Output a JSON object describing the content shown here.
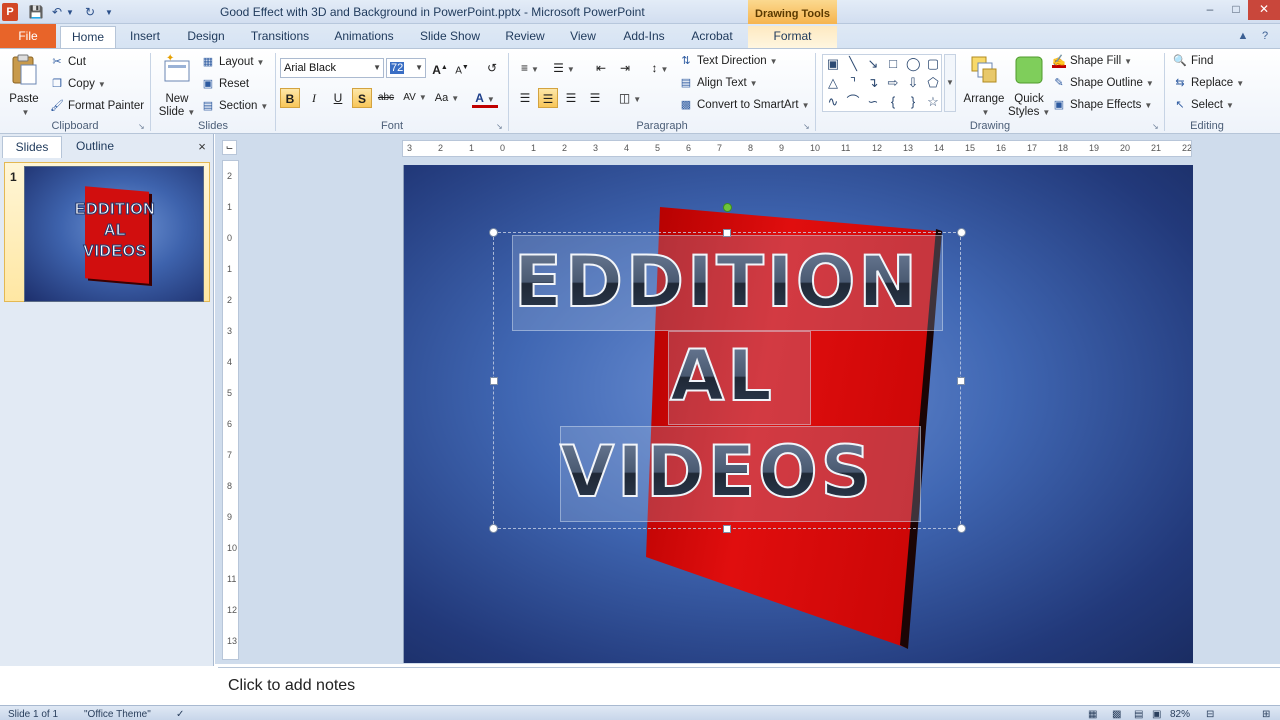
{
  "window": {
    "title": "Good Effect with 3D and Background in PowerPoint.pptx - Microsoft PowerPoint",
    "contextual_tab_group": "Drawing Tools",
    "app_icon": "P",
    "controls": {
      "minimize": "–",
      "maximize": "□",
      "close": "✕"
    }
  },
  "tabs": [
    "File",
    "Home",
    "Insert",
    "Design",
    "Transitions",
    "Animations",
    "Slide Show",
    "Review",
    "View",
    "Add-Ins",
    "Acrobat",
    "Format"
  ],
  "ribbon": {
    "clipboard": {
      "label": "Clipboard",
      "paste": "Paste",
      "cut": "Cut",
      "copy": "Copy",
      "format_painter": "Format Painter"
    },
    "slides": {
      "label": "Slides",
      "new_slide_1": "New",
      "new_slide_2": "Slide",
      "layout": "Layout",
      "reset": "Reset",
      "section": "Section"
    },
    "font": {
      "label": "Font",
      "font_name": "Arial Black",
      "font_size": "72",
      "bold": "B",
      "italic": "I",
      "underline": "U",
      "shadow": "S",
      "strike": "abc",
      "spacing": "AV",
      "case": "Aa",
      "grow": "A",
      "shrink": "A",
      "color": "A"
    },
    "paragraph": {
      "label": "Paragraph",
      "text_direction": "Text Direction",
      "align_text": "Align Text",
      "convert_smartart": "Convert to SmartArt"
    },
    "drawing": {
      "label": "Drawing",
      "arrange": "Arrange",
      "quick_styles_1": "Quick",
      "quick_styles_2": "Styles",
      "shape_fill": "Shape Fill",
      "shape_outline": "Shape Outline",
      "shape_effects": "Shape Effects"
    },
    "editing": {
      "label": "Editing",
      "find": "Find",
      "replace": "Replace",
      "select": "Select"
    }
  },
  "slides_pane": {
    "tab_slides": "Slides",
    "tab_outline": "Outline",
    "close": "×",
    "slide_number": "1",
    "thumb_lines": [
      "EDDITION",
      "AL",
      "VIDEOS"
    ]
  },
  "ruler": {
    "h_ticks": [
      "3",
      "2",
      "1",
      "0",
      "1",
      "2",
      "3",
      "4",
      "5",
      "6",
      "7",
      "8",
      "9",
      "10",
      "11",
      "12",
      "13",
      "14",
      "15",
      "16",
      "17",
      "18",
      "19",
      "20",
      "21",
      "22"
    ],
    "v_ticks": [
      "2",
      "1",
      "0",
      "1",
      "2",
      "3",
      "4",
      "5",
      "6",
      "7",
      "8",
      "9",
      "10",
      "11",
      "12",
      "13"
    ]
  },
  "slide": {
    "lines": [
      "EDDITION",
      "AL",
      "VIDEOS"
    ]
  },
  "notes": {
    "placeholder": "Click to add notes"
  },
  "status": {
    "slide_info": "Slide 1 of 1",
    "theme": "\"Office Theme\"",
    "zoom": "82%"
  },
  "colors": {
    "file_tab": "#e86429",
    "slide_red": "#d10e0e",
    "slide_blue": "#4067b3",
    "drawing_tools": "#f6b44e"
  },
  "icons": [
    "save-icon",
    "undo-icon",
    "redo-icon",
    "cut-icon",
    "copy-icon",
    "format-painter-icon",
    "layout-icon",
    "reset-icon",
    "section-icon",
    "bullets-icon",
    "numbering-icon",
    "find-icon",
    "replace-icon",
    "select-icon"
  ]
}
